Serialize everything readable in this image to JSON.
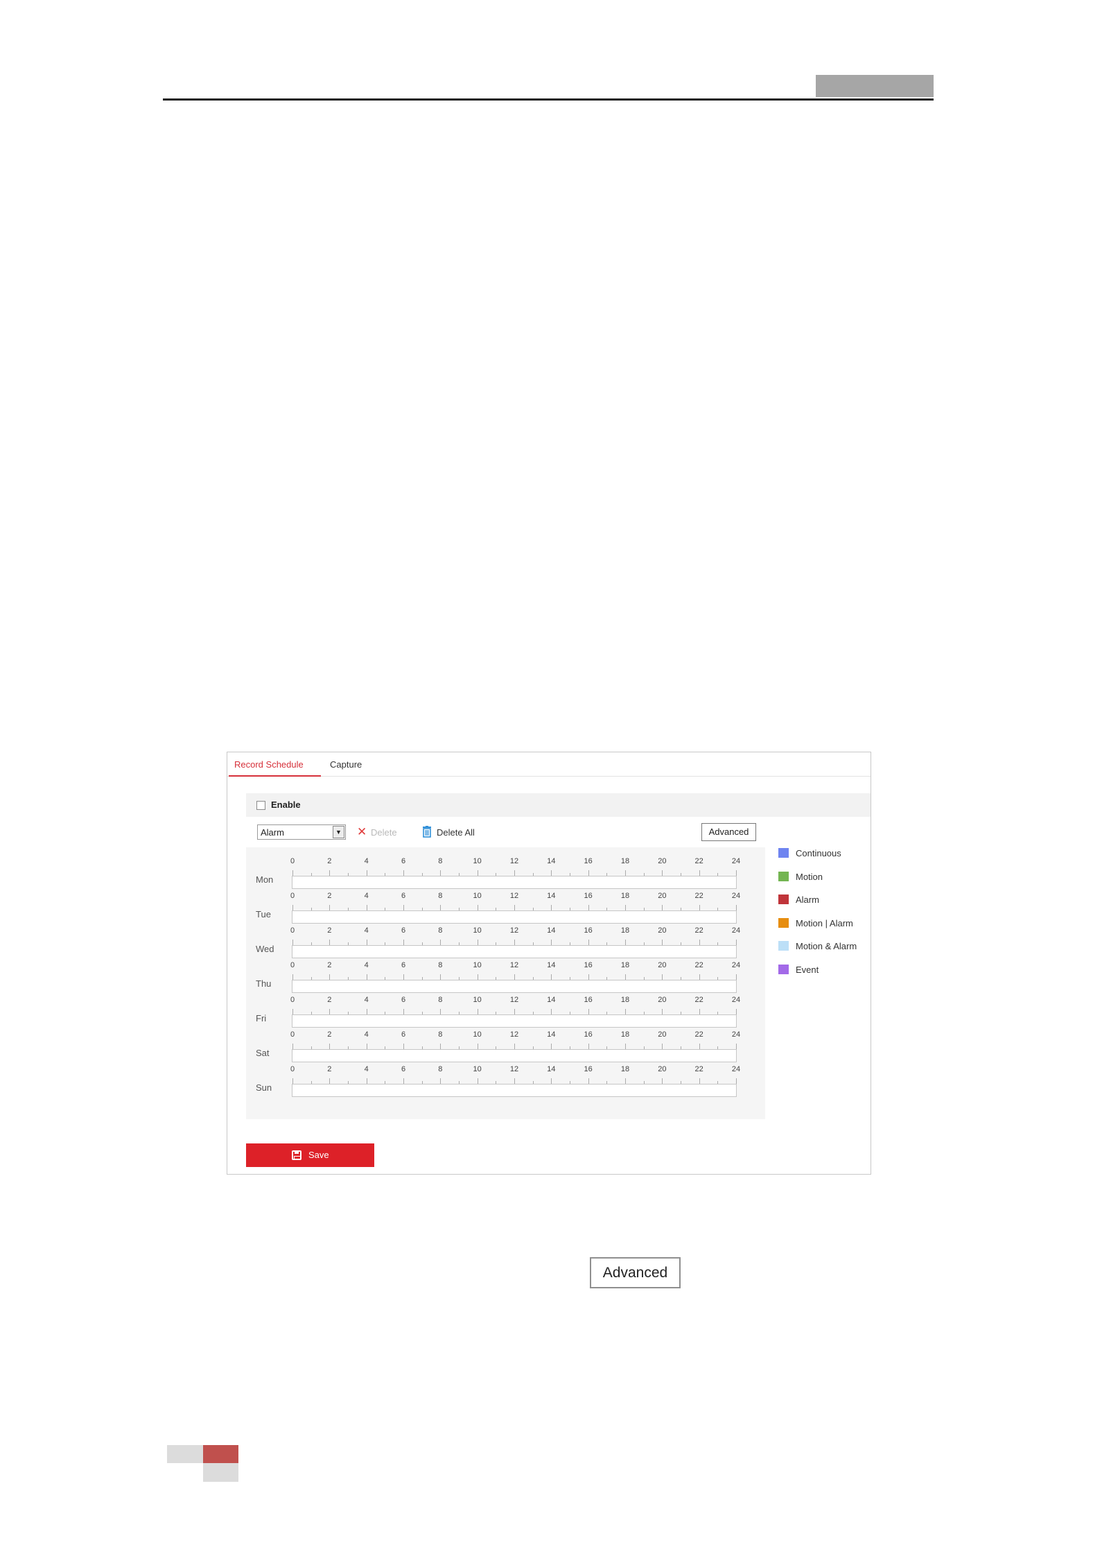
{
  "tabs": [
    {
      "label": "Record Schedule",
      "active": true
    },
    {
      "label": "Capture",
      "active": false
    }
  ],
  "enable": {
    "label": "Enable",
    "checked": false
  },
  "toolbar": {
    "schedule_type": "Alarm",
    "delete_label": "Delete",
    "delete_all_label": "Delete All",
    "advanced_label": "Advanced"
  },
  "schedule": {
    "hour_ticks": [
      "0",
      "2",
      "4",
      "6",
      "8",
      "10",
      "12",
      "14",
      "16",
      "18",
      "20",
      "22",
      "24"
    ],
    "days": [
      "Mon",
      "Tue",
      "Wed",
      "Thu",
      "Fri",
      "Sat",
      "Sun"
    ]
  },
  "legend": [
    {
      "label": "Continuous",
      "color": "#6f84f0"
    },
    {
      "label": "Motion",
      "color": "#74b552"
    },
    {
      "label": "Alarm",
      "color": "#c0353a"
    },
    {
      "label": "Motion | Alarm",
      "color": "#e78e10"
    },
    {
      "label": "Motion & Alarm",
      "color": "#bcdff7"
    },
    {
      "label": "Event",
      "color": "#a36ae8"
    }
  ],
  "save_label": "Save",
  "standalone_button": {
    "label": "Advanced"
  },
  "colors": {
    "accent": "#dd2128",
    "footer_red": "#c0504d"
  }
}
